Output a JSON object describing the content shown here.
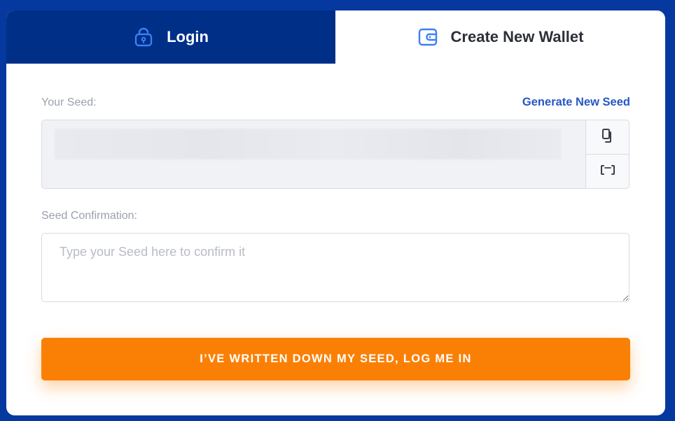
{
  "tabs": {
    "login": {
      "label": "Login",
      "icon": "lock-icon"
    },
    "create": {
      "label": "Create New Wallet",
      "icon": "wallet-icon"
    }
  },
  "seed": {
    "label": "Your Seed:",
    "generate_link": "Generate New Seed",
    "copy_icon": "copy-icon",
    "scan_icon": "scan-icon"
  },
  "confirmation": {
    "label": "Seed Confirmation:",
    "placeholder": "Type your Seed here to confirm it",
    "value": ""
  },
  "submit": {
    "label": "I’VE WRITTEN DOWN MY SEED, LOG ME IN"
  },
  "colors": {
    "background": "#05399f",
    "active_tab": "#002f88",
    "link": "#2557c4",
    "accent": "#fa8005",
    "icon_blue": "#3d7ff5"
  }
}
